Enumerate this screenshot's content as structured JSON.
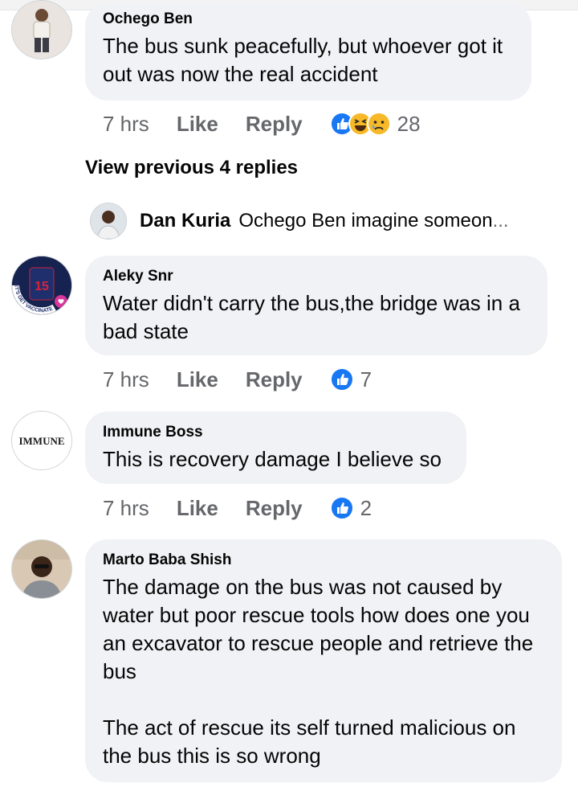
{
  "comments": [
    {
      "author": "Ochego Ben",
      "text": "The bus sunk peacefully, but whoever got it out was now the real accident",
      "time": "7 hrs",
      "like_label": "Like",
      "reply_label": "Reply",
      "reactions": [
        "like-icon",
        "laugh-icon",
        "sad-icon"
      ],
      "reaction_count": "28"
    },
    {
      "author": "Aleky Snr",
      "text": "Water didn't carry the bus,the bridge was in a bad state",
      "time": "7 hrs",
      "like_label": "Like",
      "reply_label": "Reply",
      "reactions": [
        "like-icon"
      ],
      "reaction_count": "7",
      "avatar_text": "15",
      "avatar_ring_text": "LET'S GET VACCINATED"
    },
    {
      "author": "Immune Boss",
      "text": "This is recovery damage I believe so",
      "time": "7 hrs",
      "like_label": "Like",
      "reply_label": "Reply",
      "reactions": [
        "like-icon"
      ],
      "reaction_count": "2",
      "avatar_text": "IMMUNE"
    },
    {
      "author": "Marto Baba Shish",
      "text": "The damage on the bus was not caused by water but poor rescue tools how does one you an excavator to rescue people and retrieve the bus\n\nThe act of rescue its self turned malicious on the bus this is so wrong"
    }
  ],
  "view_previous_label": "View previous 4 replies",
  "reply_preview": {
    "author": "Dan Kuria",
    "text": "Ochego Ben imagine someon",
    "ellipsis": "..."
  },
  "colors": {
    "bubble": "#f0f2f5",
    "like_blue": "#1877f2",
    "muted": "#65676b",
    "emoji_yellow": "#f7b928"
  }
}
